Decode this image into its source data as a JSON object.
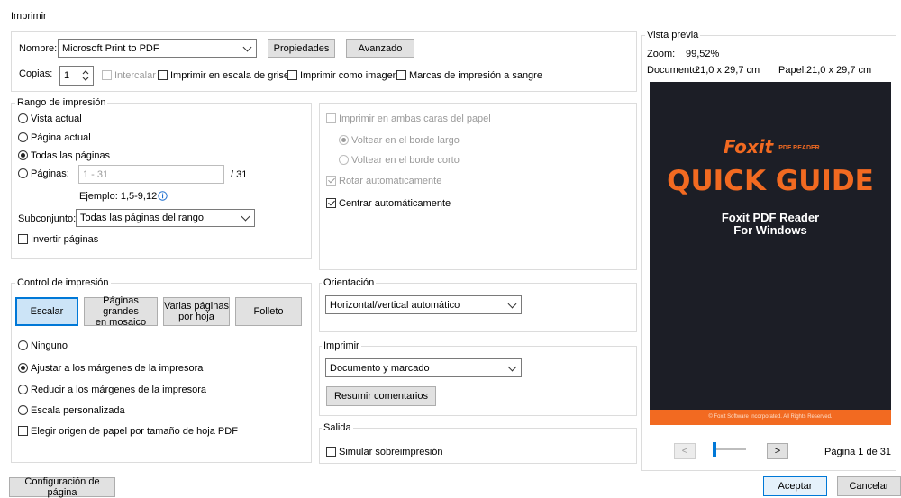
{
  "window": {
    "title": "Imprimir"
  },
  "printer": {
    "name_label": "Nombre:",
    "name_value": "Microsoft Print to PDF",
    "properties_button": "Propiedades",
    "advanced_button": "Avanzado",
    "copies_label": "Copias:",
    "copies_value": "1",
    "collate_label": "Intercalar",
    "grayscale_label": "Imprimir en escala de grises",
    "as_image_label": "Imprimir como imagen",
    "bleed_label": "Marcas de impresión a sangre"
  },
  "range": {
    "title": "Rango de impresión",
    "current_view": "Vista actual",
    "current_page": "Página actual",
    "all_pages": "Todas las páginas",
    "pages_label": "Páginas:",
    "pages_value": "1 - 31",
    "pages_total": "/ 31",
    "example": "Ejemplo: 1,5-9,12",
    "subset_label": "Subconjunto:",
    "subset_value": "Todas las páginas del rango",
    "reverse_label": "Invertir páginas"
  },
  "duplex": {
    "both_sides": "Imprimir en ambas caras del papel",
    "long_edge": "Voltear en el borde largo",
    "short_edge": "Voltear en el borde corto",
    "auto_rotate": "Rotar automáticamente",
    "auto_center": "Centrar automáticamente"
  },
  "control": {
    "title": "Control de impresión",
    "scale_button": "Escalar",
    "tile_button_1": "Páginas grandes",
    "tile_button_2": "en mosaico",
    "multiple_button_1": "Varias páginas",
    "multiple_button_2": "por hoja",
    "booklet_button": "Folleto",
    "none": "Ninguno",
    "fit_margins": "Ajustar a los márgenes de la impresora",
    "shrink_margins": "Reducir a los márgenes de la impresora",
    "custom_scale": "Escala personalizada",
    "paper_source": "Elegir origen de papel por tamaño de hoja PDF"
  },
  "orientation": {
    "title": "Orientación",
    "value": "Horizontal/vertical automático"
  },
  "print_what": {
    "title": "Imprimir",
    "value": "Documento y marcado",
    "summarize_button": "Resumir comentarios"
  },
  "output": {
    "title": "Salida",
    "overprint": "Simular sobreimpresión"
  },
  "preview": {
    "title": "Vista previa",
    "zoom_label": "Zoom:",
    "zoom_value": "99,52%",
    "document_label": "Documento:",
    "document_value": "21,0 x 29,7 cm",
    "paper_label": "Papel:",
    "paper_value": "21,0 x 29,7 cm",
    "cover_brand": "Foxit",
    "cover_brand_sub": "PDF READER",
    "cover_heading": "QUICK GUIDE",
    "cover_line1": "Foxit PDF Reader",
    "cover_line2": "For Windows",
    "cover_footer": "© Foxit Software Incorporated. All Rights Reserved.",
    "cover_bg": "#1c1e26",
    "cover_accent": "#f26a21",
    "prev": "<",
    "next": ">",
    "page_indicator": "Página 1 de 31"
  },
  "footer": {
    "page_setup_button": "Configuración de página",
    "ok_button": "Aceptar",
    "cancel_button": "Cancelar"
  }
}
